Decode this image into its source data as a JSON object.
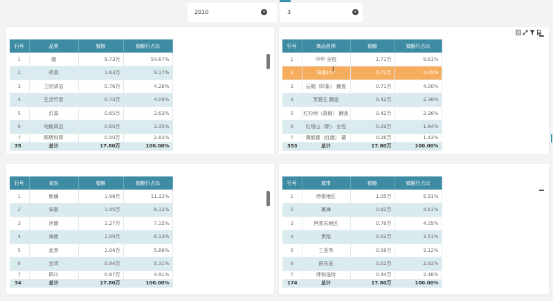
{
  "filters": [
    {
      "value": "2010"
    },
    {
      "value": "3"
    }
  ],
  "tables": {
    "category": {
      "headers": [
        "行号",
        "品类",
        "销额",
        "销额行占比"
      ],
      "rows": [
        [
          "1",
          "烟",
          "9.73万",
          "54.67%"
        ],
        [
          "2",
          "杯具",
          "1.63万",
          "9.17%"
        ],
        [
          "3",
          "卫浴请洁",
          "0.76万",
          "4.26%"
        ],
        [
          "4",
          "生活竹炭",
          "0.73万",
          "4.09%"
        ],
        [
          "5",
          "灯具",
          "0.65万",
          "3.63%"
        ],
        [
          "6",
          "电脑周边",
          "0.60万",
          "3.35%"
        ],
        [
          "7",
          "照明科荐",
          "0.50万",
          "2.82%"
        ]
      ],
      "total": [
        "35",
        "总计",
        "17.80万",
        "100.00%"
      ]
    },
    "product": {
      "headers": [
        "行号",
        "商品名称",
        "销额",
        "销额行占比"
      ],
      "rows": [
        [
          "1",
          "中华 全包",
          "1.71万",
          "9.61%"
        ],
        [
          "2",
          "洞翁157",
          "0.72万",
          "4.05%"
        ],
        [
          "3",
          "云烟（印象） 翻盖",
          "0.71万",
          "4.00%"
        ],
        [
          "4",
          "芙蓉王 翻盖",
          "0.42万",
          "2.36%"
        ],
        [
          "5",
          "红杉树（高级） 翻盖",
          "0.42万",
          "2.36%"
        ],
        [
          "6",
          "红塔山（新） 全包",
          "0.29万",
          "1.64%"
        ],
        [
          "7",
          "黄鹤楼（红版） 硬",
          "0.26万",
          "1.43%"
        ]
      ],
      "total": [
        "353",
        "总计",
        "17.80万",
        "100.00%"
      ]
    },
    "province": {
      "headers": [
        "行号",
        "省份",
        "销额",
        "销额行占比"
      ],
      "rows": [
        [
          "1",
          "新疆",
          "1.98万",
          "11.12%"
        ],
        [
          "2",
          "安徽",
          "1.45万",
          "8.12%"
        ],
        [
          "3",
          "河南",
          "1.27万",
          "7.15%"
        ],
        [
          "4",
          "海南",
          "1.09万",
          "6.13%"
        ],
        [
          "5",
          "北京",
          "1.04万",
          "5.86%"
        ],
        [
          "6",
          "台湾",
          "0.94万",
          "5.31%"
        ],
        [
          "7",
          "四川",
          "0.87万",
          "4.91%"
        ]
      ],
      "total": [
        "34",
        "总计",
        "17.80万",
        "100.00%"
      ]
    },
    "city": {
      "headers": [
        "行号",
        "城市",
        "销额",
        "销额行占比"
      ],
      "rows": [
        [
          "1",
          "哈密地区",
          "1.05万",
          "5.91%"
        ],
        [
          "2",
          "冀海",
          "0.82万",
          "4.61%"
        ],
        [
          "3",
          "阿克苏地区",
          "0.78万",
          "4.35%"
        ],
        [
          "4",
          "贵阳",
          "0.62万",
          "3.51%"
        ],
        [
          "5",
          "三亚市",
          "0.56万",
          "3.12%"
        ],
        [
          "6",
          "屏东县",
          "0.52万",
          "2.92%"
        ],
        [
          "7",
          "呼和浩特",
          "0.44万",
          "2.46%"
        ]
      ],
      "total": [
        "174",
        "总计",
        "17.80万",
        "100.00%"
      ]
    }
  },
  "colors": {
    "header": "#3e8ba4",
    "alt_row": "#d9ebef",
    "highlight_row": "#f6ad5d"
  },
  "icons": {
    "toolbar": [
      "export-excel-icon",
      "fullscreen-icon",
      "filter-icon",
      "export-pdf-icon"
    ]
  }
}
